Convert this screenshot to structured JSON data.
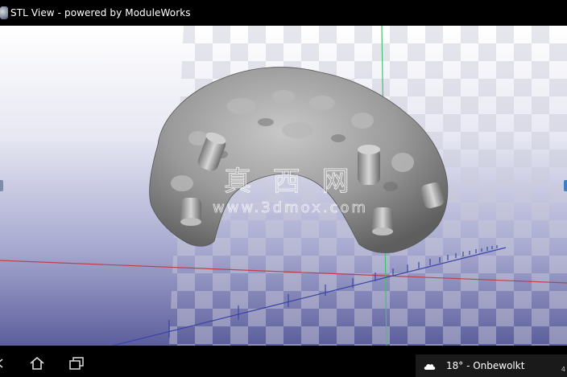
{
  "window": {
    "title": "STL View - powered by ModuleWorks",
    "app_icon": "moduleworks-globe-icon"
  },
  "viewport": {
    "background_top": "#ffffff",
    "background_bottom": "#5c5e9c",
    "x_axis_color": "#c0404a",
    "z_axis_color": "#44c070",
    "y_axis_color": "#3a46a8",
    "model_color": "#9a9a9a",
    "watermark_cn": "真 西 网",
    "watermark_url": "www.3dmox.com"
  },
  "navbar": {
    "back_icon": "back-icon",
    "home_icon": "home-icon",
    "recent_icon": "recent-apps-icon"
  },
  "weather": {
    "icon": "cloud-icon",
    "text": "18° - Onbewolkt",
    "page": "4"
  }
}
